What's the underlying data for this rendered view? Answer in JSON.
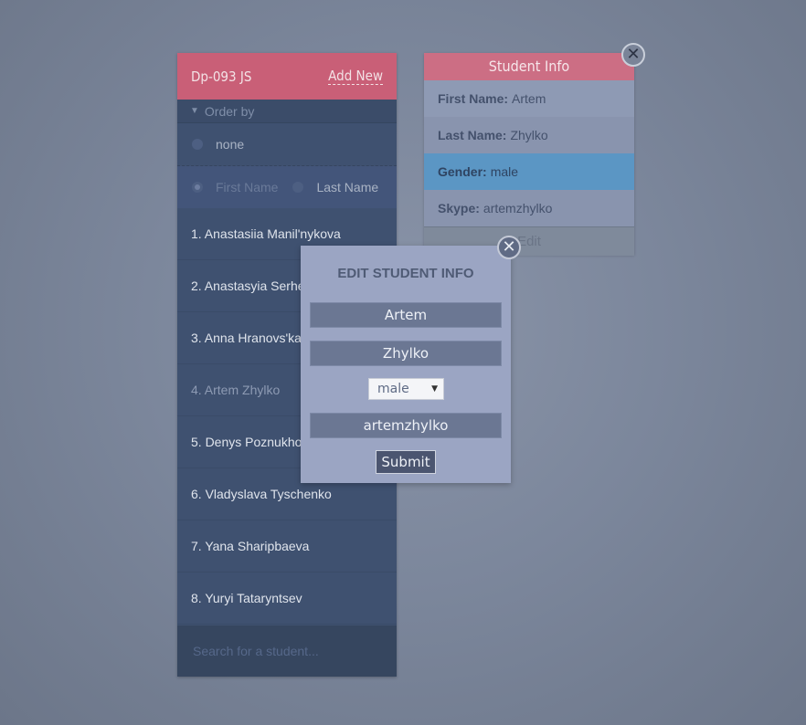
{
  "list": {
    "title": "Dp-093 JS",
    "add_new": "Add New",
    "order_by": "Order by",
    "order_options": {
      "none": "none",
      "first_name": "First Name",
      "last_name": "Last Name"
    },
    "students": [
      "1. Anastasiia Manil'nykova",
      "2. Anastasyia Serheeva",
      "3. Anna Hranovs'ka",
      "4. Artem Zhylko",
      "5. Denys Poznukhov",
      "6. Vladyslava Tyschenko",
      "7. Yana Sharipbaeva",
      "8. Yuryi Tataryntsev"
    ],
    "search_placeholder": "Search for a student..."
  },
  "info": {
    "title": "Student Info",
    "first_name_label": "First Name:",
    "first_name": "Artem",
    "last_name_label": "Last Name:",
    "last_name": "Zhylko",
    "gender_label": "Gender:",
    "gender": "male",
    "skype_label": "Skype:",
    "skype": "artemzhylko",
    "edit": "Edit"
  },
  "modal": {
    "title": "EDIT STUDENT INFO",
    "first_name": "Artem",
    "last_name": "Zhylko",
    "gender": "male",
    "skype": "artemzhylko",
    "submit": "Submit"
  },
  "icons": {
    "close": "close-icon",
    "order_toggle": "triangle-down-icon",
    "close_glyph": "✕"
  }
}
